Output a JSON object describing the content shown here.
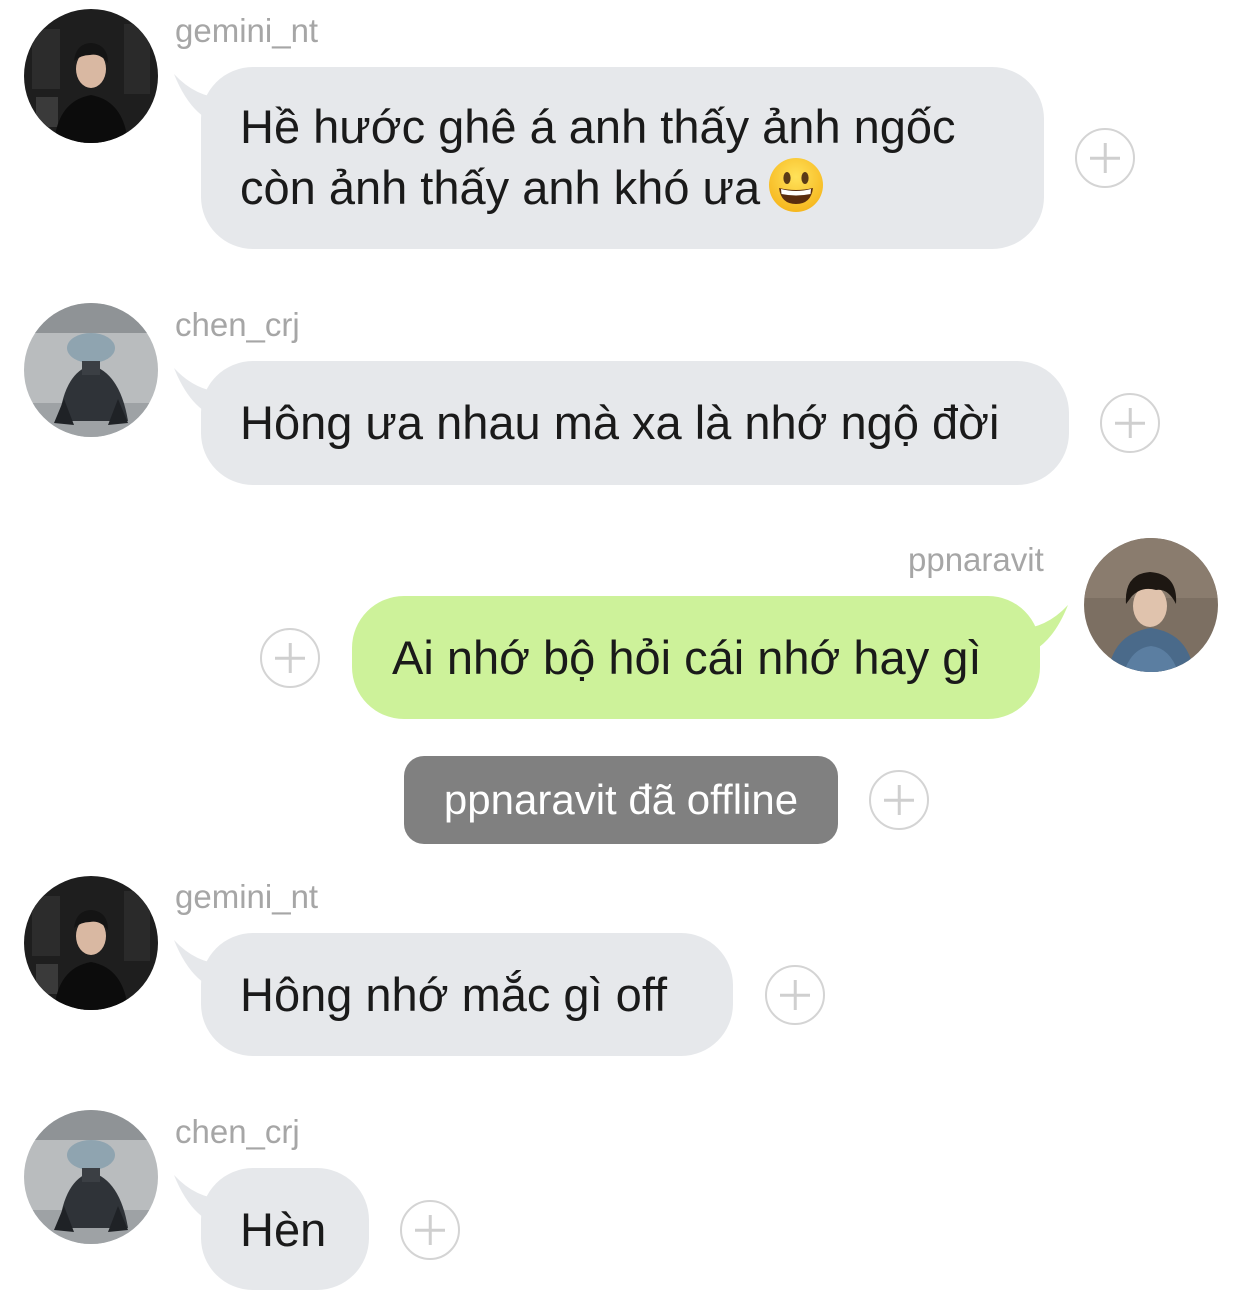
{
  "colors": {
    "incoming_bubble": "#e6e8eb",
    "outgoing_bubble": "#cdf29a",
    "system_pill": "#808080",
    "username_text": "#a6a6a6",
    "reaction_icon": "#d4d4d4"
  },
  "messages": [
    {
      "sender": "gemini_nt",
      "direction": "incoming",
      "line1": "Hề hước ghê á anh thấy ảnh ngốc",
      "line2": "còn ảnh thấy anh khó ưa",
      "emoji": "grinning-face"
    },
    {
      "sender": "chen_crj",
      "direction": "incoming",
      "text": "Hông ưa nhau mà xa là nhớ ngộ đời"
    },
    {
      "sender": "ppnaravit",
      "direction": "outgoing",
      "text": "Ai nhớ bộ hỏi cái nhớ hay gì"
    },
    {
      "sender": "gemini_nt",
      "direction": "incoming",
      "text": "Hông nhớ mắc gì off"
    },
    {
      "sender": "chen_crj",
      "direction": "incoming",
      "text": "Hèn"
    }
  ],
  "system_notice": {
    "text": "ppnaravit đã offline"
  },
  "icons": {
    "reaction": "plus-circle-icon"
  }
}
